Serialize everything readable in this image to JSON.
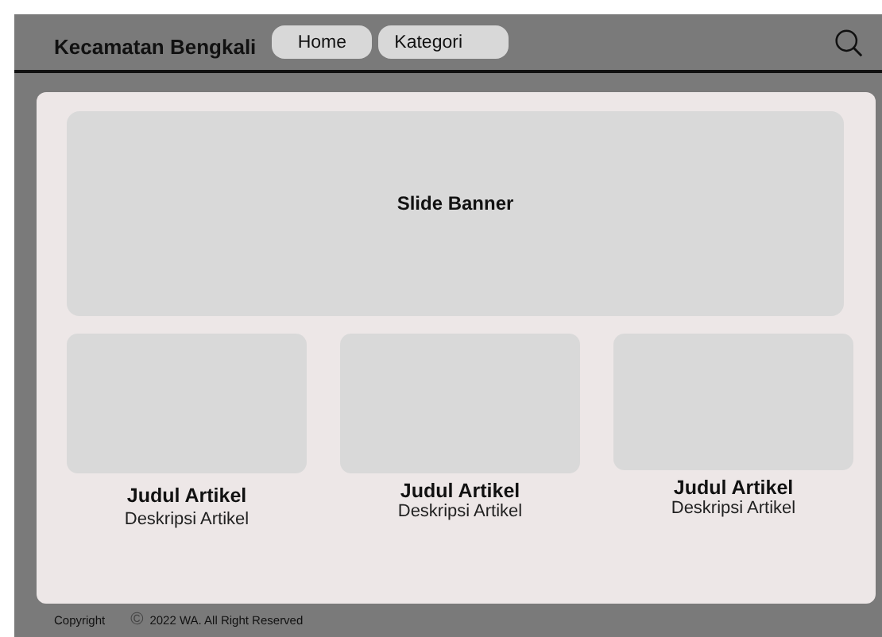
{
  "header": {
    "title": "Kecamatan Bengkali",
    "nav": [
      {
        "label": "Home"
      },
      {
        "label": "Kategori"
      }
    ]
  },
  "banner": {
    "label": "Slide Banner"
  },
  "articles": [
    {
      "title": "Judul Artikel",
      "description": "Deskripsi Artikel"
    },
    {
      "title": "Judul Artikel",
      "description": "Deskripsi Artikel"
    },
    {
      "title": "Judul Artikel",
      "description": "Deskripsi Artikel"
    }
  ],
  "footer": {
    "label": "Copyright",
    "symbol": "©",
    "text": "2022 WA. All Right Reserved"
  }
}
